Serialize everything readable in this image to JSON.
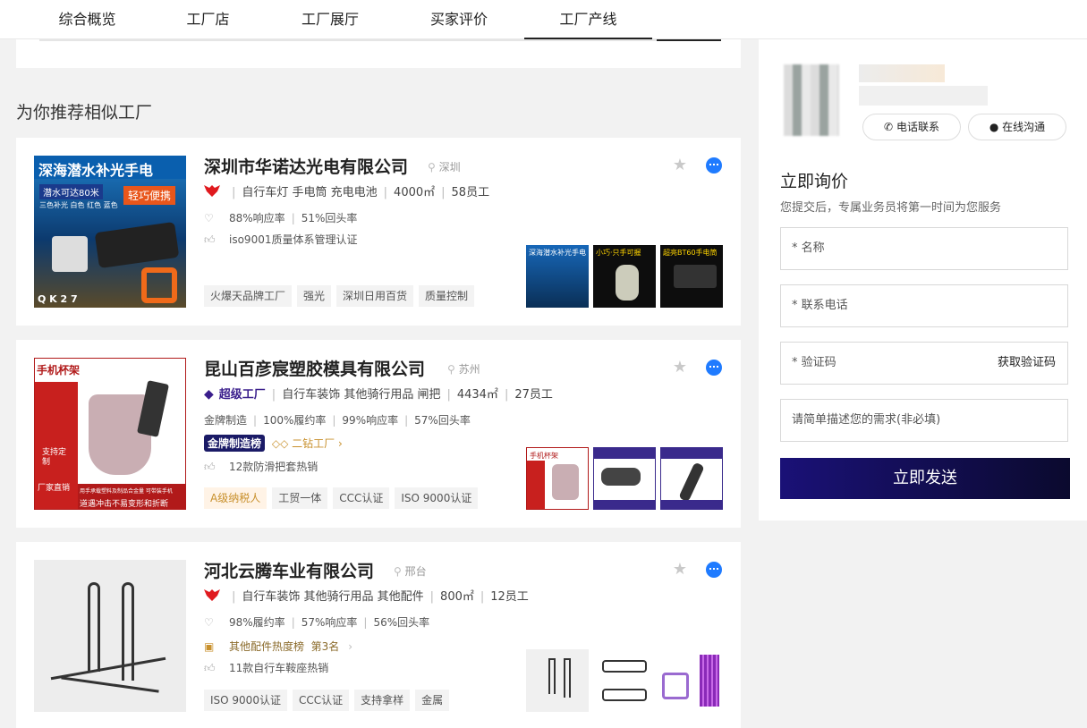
{
  "tabs": [
    "综合概览",
    "工厂店",
    "工厂展厅",
    "买家评价",
    "工厂产线"
  ],
  "active_tab": "工厂产线",
  "section_title": "为你推荐相似工厂",
  "cards": [
    {
      "name": "深圳市华诺达光电有限公司",
      "city": "深圳",
      "main_products": "自行车灯 手电筒 充电电池",
      "area": "4000㎡",
      "staff": "58员工",
      "metrics": [
        "88%响应率",
        "51%回头率"
      ],
      "highlight": "iso9001质量体系管理认证",
      "tags": [
        "火爆天品牌工厂",
        "强光",
        "深圳日用百货",
        "质量控制"
      ],
      "image_text": [
        "深海潜水补光手电",
        "潜水可达80米",
        "轻巧便携",
        "三色补光",
        "白色",
        "红色",
        "蓝色",
        "Q K 2 7"
      ],
      "thumbs": [
        "深海潜水补光手电",
        "小巧·只手可握",
        "超亮BT60手电筒"
      ]
    },
    {
      "name": "昆山百彦宸塑胶模具有限公司",
      "city": "苏州",
      "level": "超级工厂",
      "main_products": "自行车装饰 其他骑行用品 闸把",
      "area": "4434㎡",
      "staff": "27员工",
      "metrics": [
        "金牌制造",
        "100%履约率",
        "99%响应率",
        "57%回头率"
      ],
      "badge_gold": "金牌制造榜",
      "badge_diamond": "二钻工厂",
      "highlight": "12款防滑把套热销",
      "tags": [
        "A级纳税人",
        "工贸一体",
        "CCC认证",
        "ISO 9000认证"
      ],
      "image_text": [
        "手机杯架",
        "支持定制",
        "厂家直销",
        "用手承载塑料及制品合金量 可带装手机",
        "道遇冲击不易变形和折断"
      ],
      "thumbs": [
        "手机杯架",
        "",
        "",
        ""
      ]
    },
    {
      "name": "河北云腾车业有限公司",
      "city": "邢台",
      "main_products": "自行车装饰 其他骑行用品 其他配件",
      "area": "800㎡",
      "staff": "12员工",
      "metrics": [
        "98%履约率",
        "57%响应率",
        "56%回头率"
      ],
      "ranking": "其他配件热度榜",
      "ranking_place": "第3名",
      "highlight": "11款自行车鞍座热销",
      "tags": [
        "ISO 9000认证",
        "CCC认证",
        "支持拿样",
        "金属"
      ]
    }
  ],
  "sidebar": {
    "call_label": "电话联系",
    "chat_label": "在线沟通",
    "form_title": "立即询价",
    "form_subtitle": "您提交后，专属业务员将第一时间为您服务",
    "name_placeholder": "* 名称",
    "phone_placeholder": "* 联系电话",
    "code_placeholder": "* 验证码",
    "get_code": "获取验证码",
    "desc_placeholder": "请简单描述您的需求(非必填)",
    "submit": "立即发送"
  },
  "colors": {
    "brand_dark": "#1a1177",
    "chat_blue": "#1f7bff",
    "logo_red": "#e0191e",
    "gold": "#c8902c"
  }
}
